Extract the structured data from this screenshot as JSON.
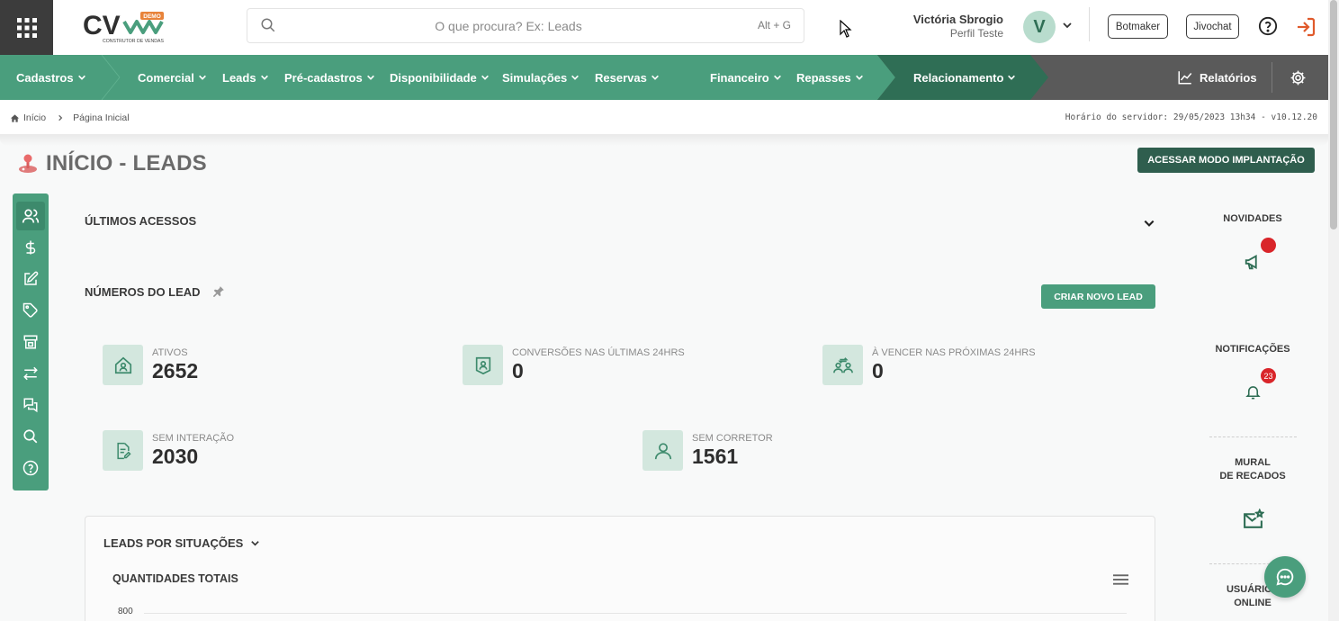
{
  "header": {
    "logo_text": "CV",
    "logo_badge": "DEMO",
    "logo_tagline": "CONSTRUTOR DE VENDAS",
    "search_placeholder": "O que procura? Ex: Leads",
    "search_shortcut": "Alt + G",
    "user_name": "Victória Sbrogio",
    "user_profile": "Perfil Teste",
    "avatar_initial": "V",
    "botmaker_label": "Botmaker",
    "jivochat_label": "Jivochat"
  },
  "nav": {
    "items": [
      {
        "label": "Cadastros"
      },
      {
        "label": "Comercial"
      },
      {
        "label": "Leads"
      },
      {
        "label": "Pré-cadastros"
      },
      {
        "label": "Disponibilidade"
      },
      {
        "label": "Simulações"
      },
      {
        "label": "Reservas"
      },
      {
        "label": "Financeiro"
      },
      {
        "label": "Repasses"
      },
      {
        "label": "Relacionamento"
      }
    ],
    "reports_label": "Relatórios"
  },
  "breadcrumb": {
    "home": "Início",
    "current": "Página Inicial",
    "server_time": "Horário do servidor: 29/05/2023 13h34 - v10.12.20"
  },
  "page": {
    "title": "INÍCIO - LEADS",
    "implant_button": "ACESSAR MODO IMPLANTAÇÃO"
  },
  "sections": {
    "last_access": "ÚLTIMOS ACESSOS",
    "lead_numbers": "NÚMEROS DO LEAD",
    "new_lead_button": "CRIAR NOVO LEAD"
  },
  "metrics": [
    {
      "label": "ATIVOS",
      "value": "2652"
    },
    {
      "label": "CONVERSÕES NAS ÚLTIMAS 24hrs",
      "value": "0"
    },
    {
      "label": "À VENCER NAS PRÓXIMAS 24hrs",
      "value": "0"
    },
    {
      "label": "SEM INTERAÇÃO",
      "value": "2030"
    },
    {
      "label": "SEM CORRETOR",
      "value": "1561"
    }
  ],
  "chart_card": {
    "title": "LEADS POR SITUAÇÕES",
    "subtitle": "QUANTIDADES TOTAIS",
    "y_tick_top": "800"
  },
  "right_sidebar": {
    "news": "NOVIDADES",
    "notifications": "NOTIFICAÇÕES",
    "notifications_count": "23",
    "mural_line1": "MURAL",
    "mural_line2": "DE RECADOS",
    "online_line1": "USUÁRIOS",
    "online_line2": "ONLINE"
  },
  "colors": {
    "primary_green": "#4a9e7d",
    "dark_green": "#2f5e4e",
    "nav_gray": "#5a5a5a",
    "alert_red": "#d9252a"
  }
}
